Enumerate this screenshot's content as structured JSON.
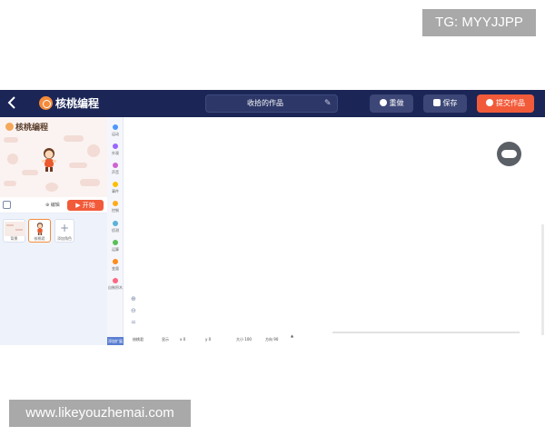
{
  "watermarks": {
    "top": "TG: MYYJJPP",
    "bottom": "www.likeyouzhemai.com"
  },
  "topbar": {
    "back_icon": "chevron-left-icon",
    "logo_text": "核桃编程",
    "project_title": "收拾的作品",
    "reset_label": "重做",
    "save_label": "保存",
    "submit_label": "提交作品",
    "colors": {
      "bar": "#1b2656",
      "accent": "#f25b3a"
    }
  },
  "stage": {
    "logo_text": "核桃编程",
    "edit_label": "编辑",
    "start_label": "▶ 开始"
  },
  "sprites": {
    "items": [
      {
        "label": "背景"
      },
      {
        "label": "核桃君"
      }
    ],
    "add_label": "添加角色"
  },
  "categories": {
    "items": [
      {
        "label": "运动",
        "color": "#4c97ff"
      },
      {
        "label": "外观",
        "color": "#9966ff"
      },
      {
        "label": "声音",
        "color": "#cf63cf"
      },
      {
        "label": "事件",
        "color": "#ffbf00"
      },
      {
        "label": "控制",
        "color": "#ffab19"
      },
      {
        "label": "侦测",
        "color": "#5cb1d6"
      },
      {
        "label": "运算",
        "color": "#59c059"
      },
      {
        "label": "变量",
        "color": "#ff8c1a"
      },
      {
        "label": "自制积木",
        "color": "#ff6680"
      }
    ],
    "extension_label": "添加扩展"
  },
  "status": {
    "sprite_name": "核桃君",
    "x_label": "x 0",
    "y_label": "y 0",
    "size_label": "大小 100",
    "direction_label": "方向 90",
    "visible_label": "显示"
  }
}
